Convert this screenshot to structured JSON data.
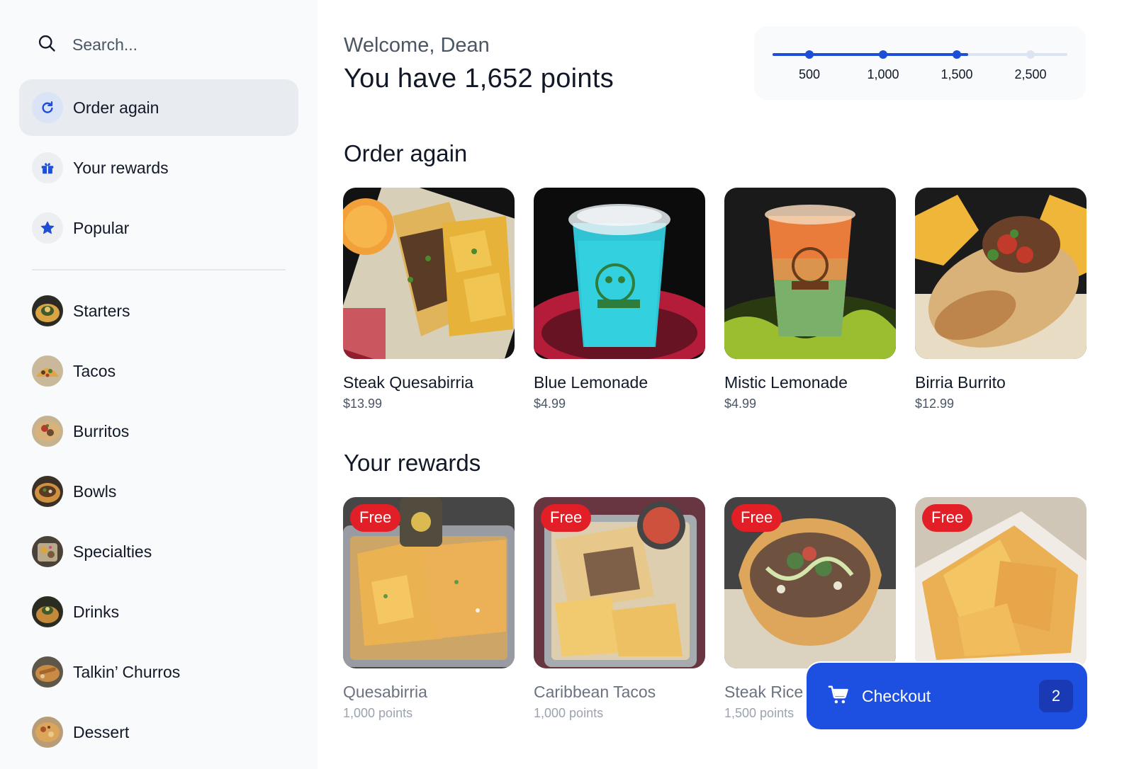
{
  "sidebar": {
    "search": {
      "placeholder": "Search..."
    },
    "nav": [
      {
        "label": "Order again",
        "icon": "refresh-icon",
        "active": true
      },
      {
        "label": "Your rewards",
        "icon": "gift-icon",
        "active": false
      },
      {
        "label": "Popular",
        "icon": "star-icon",
        "active": false
      }
    ],
    "categories": [
      {
        "label": "Starters"
      },
      {
        "label": "Tacos"
      },
      {
        "label": "Burritos"
      },
      {
        "label": "Bowls"
      },
      {
        "label": "Specialties"
      },
      {
        "label": "Drinks"
      },
      {
        "label": "Talkin’ Churros"
      },
      {
        "label": "Dessert"
      }
    ]
  },
  "header": {
    "welcome": "Welcome, Dean",
    "points": "You have 1,652 points"
  },
  "rewards_progress": {
    "current_points": 1652,
    "max_points": 2500,
    "ticks": [
      {
        "label": "500",
        "value": 500
      },
      {
        "label": "1,000",
        "value": 1000
      },
      {
        "label": "1,500",
        "value": 1500
      },
      {
        "label": "2,500",
        "value": 2500
      }
    ],
    "accent": "#1d4ed8"
  },
  "order_again": {
    "title": "Order again",
    "items": [
      {
        "name": "Steak Quesabirria",
        "price": "$13.99",
        "image": "quesabirria-tray"
      },
      {
        "name": "Blue Lemonade",
        "price": "$4.99",
        "image": "blue-drink-cup"
      },
      {
        "name": "Mistic Lemonade",
        "price": "$4.99",
        "image": "orange-green-drink-cup"
      },
      {
        "name": "Birria Burrito",
        "price": "$12.99",
        "image": "burrito-with-chips"
      }
    ]
  },
  "your_rewards": {
    "title": "Your rewards",
    "badge": "Free",
    "items": [
      {
        "name": "Quesabirria",
        "points": "1,000 points",
        "image": "quesabirria-platter"
      },
      {
        "name": "Caribbean Tacos",
        "points": "1,000 points",
        "image": "tacos-with-chips"
      },
      {
        "name": "Steak Rice",
        "points": "1,500 points",
        "image": "taco-bowl"
      },
      {
        "name": "",
        "points": "",
        "image": "tortilla-chips"
      }
    ]
  },
  "checkout": {
    "label": "Checkout",
    "count": "2",
    "color": "#1d4fe0"
  }
}
